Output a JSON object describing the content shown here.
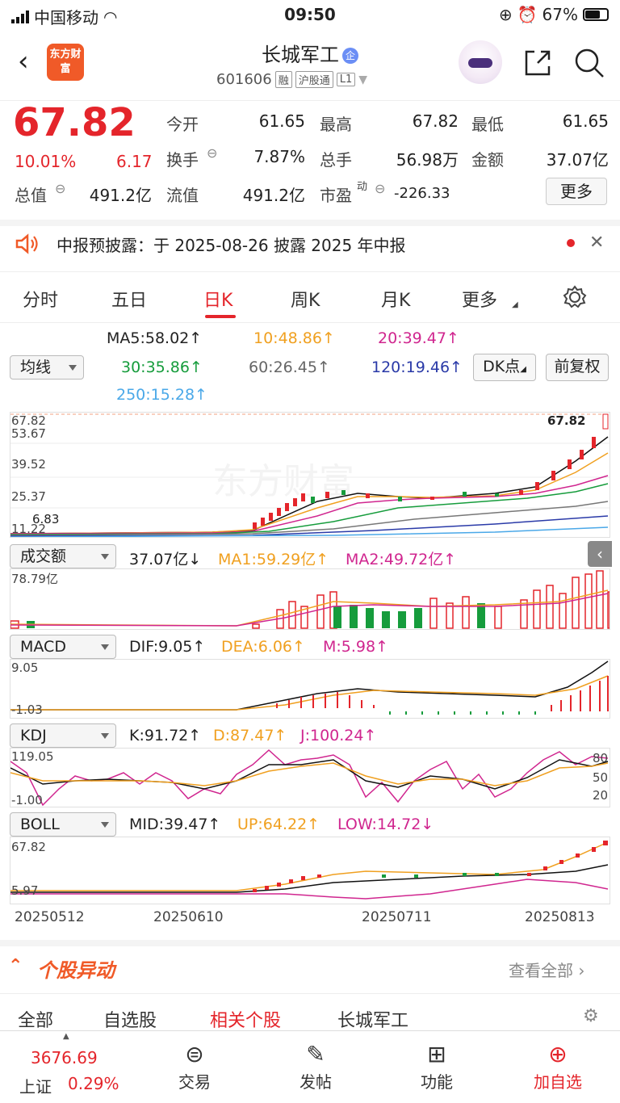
{
  "status_bar": {
    "carrier": "中国移动",
    "time": "09:50",
    "battery": "67%"
  },
  "header": {
    "logo_text": "东方财富",
    "stock_name": "长城军工",
    "qi_badge": "企",
    "code": "601606",
    "tags": [
      "融",
      "沪股通",
      "L1"
    ]
  },
  "quote": {
    "price": "67.82",
    "change_pct": "10.01%",
    "change": "6.17",
    "open_label": "今开",
    "open": "61.65",
    "high_label": "最高",
    "high": "67.82",
    "low_label": "最低",
    "low": "61.65",
    "turnover_label": "换手",
    "turnover": "7.87%",
    "volume_label": "总手",
    "volume": "56.98万",
    "amount_label": "金额",
    "amount": "37.07亿",
    "mktcap_label": "总值",
    "mktcap": "491.2亿",
    "float_label": "流值",
    "float_cap": "491.2亿",
    "pe_label": "市盈",
    "pe_sup": "动",
    "pe": "-226.33",
    "more_label": "更多"
  },
  "notice": {
    "text": "中报预披露：于 2025-08-26 披露 2025 年中报"
  },
  "tabs": [
    "分时",
    "五日",
    "日K",
    "周K",
    "月K",
    "更多"
  ],
  "active_tab": "日K",
  "ma_select": "均线",
  "ma": {
    "ma5": "MA5:58.02↑",
    "ma10": "10:48.86↑",
    "ma20": "20:39.47↑",
    "ma30": "30:35.86↑",
    "ma60": "60:26.45↑",
    "ma120": "120:19.46↑",
    "ma250": "250:15.28↑"
  },
  "dk_button": "DK点",
  "adjust_button": "前复权",
  "kline": {
    "axis": [
      "67.82",
      "53.67",
      "39.52",
      "25.37",
      "11.22"
    ],
    "last_price": "67.82",
    "left_label": "6.83"
  },
  "volume": {
    "select": "成交额",
    "value": "37.07亿↓",
    "ma1": "MA1:59.29亿↑",
    "ma2": "MA2:49.72亿↑",
    "axis_top": "78.79亿"
  },
  "macd": {
    "select": "MACD",
    "dif": "DIF:9.05↑",
    "dea": "DEA:6.06↑",
    "m": "M:5.98↑",
    "axis_top": "9.05",
    "axis_bottom": "-1.03"
  },
  "kdj": {
    "select": "KDJ",
    "k": "K:91.72↑",
    "d": "D:87.47↑",
    "j": "J:100.24↑",
    "axis_top": "119.05",
    "axis_bottom": "-1.00",
    "levels": [
      "80",
      "50",
      "20"
    ]
  },
  "boll": {
    "select": "BOLL",
    "mid": "MID:39.47↑",
    "up": "UP:64.22↑",
    "low": "LOW:14.72↓",
    "axis_top": "67.82",
    "axis_bottom": "5.97"
  },
  "dates": [
    "20250512",
    "20250610",
    "20250711",
    "20250813"
  ],
  "section": {
    "title": "个股异动",
    "view_all": "查看全部"
  },
  "sub_tabs": [
    "全部",
    "自选股",
    "相关个股",
    "长城军工"
  ],
  "tab_bar": {
    "index_value": "3676.69",
    "index_name": "上证",
    "index_change": "0.29%",
    "items": [
      "交易",
      "发帖",
      "功能",
      "加自选"
    ]
  },
  "colors": {
    "up": "#e4252b",
    "down": "#169c3c",
    "accent": "#f05a28"
  }
}
